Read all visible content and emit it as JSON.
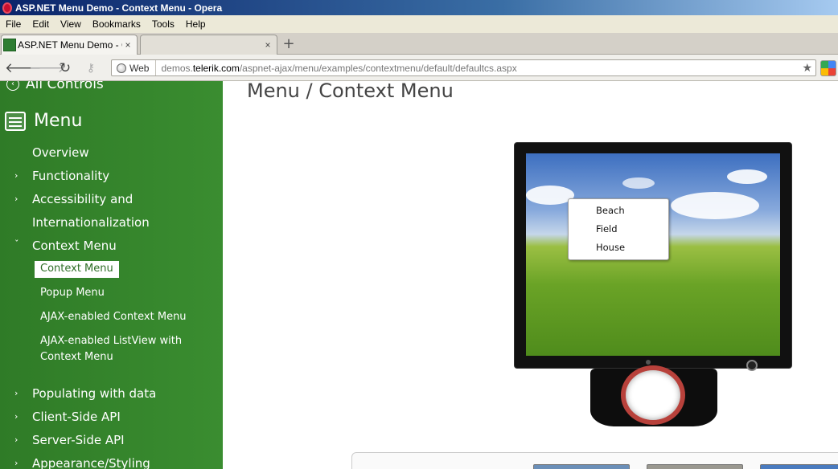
{
  "window": {
    "title": "ASP.NET Menu Demo - Context Menu - Opera"
  },
  "menubar": {
    "items": [
      "File",
      "Edit",
      "View",
      "Bookmarks",
      "Tools",
      "Help"
    ]
  },
  "tabs": [
    {
      "label": "ASP.NET Menu Demo - C...",
      "close": "×"
    },
    {
      "label": "",
      "close": "×"
    }
  ],
  "newtab": "+",
  "address": {
    "badge": "Web",
    "domain_prefix": "demos.",
    "domain": "telerik.com",
    "path": "/aspnet-ajax/menu/examples/contextmenu/default/defaultcs.aspx"
  },
  "sidebar": {
    "all_controls": "All Controls",
    "menu_heading": "Menu",
    "items": {
      "overview": "Overview",
      "functionality": "Functionality",
      "accessibility_1": "Accessibility and",
      "accessibility_2": "Internationalization",
      "context_menu": "Context Menu",
      "populating": "Populating with data",
      "client_api": "Client-Side API",
      "server_api": "Server-Side API",
      "appearance": "Appearance/Styling"
    },
    "subitems": {
      "context_menu": "Context Menu",
      "popup_menu": "Popup Menu",
      "ajax_context": "AJAX-enabled Context Menu",
      "ajax_listview_1": "AJAX-enabled ListView with",
      "ajax_listview_2": "Context Menu"
    }
  },
  "page": {
    "title": "Menu / Context Menu"
  },
  "context_menu": {
    "items": [
      "Beach",
      "Field",
      "House"
    ]
  },
  "colors": {
    "sidebar": "#3a8d30",
    "title_bar": "#0a246a"
  }
}
